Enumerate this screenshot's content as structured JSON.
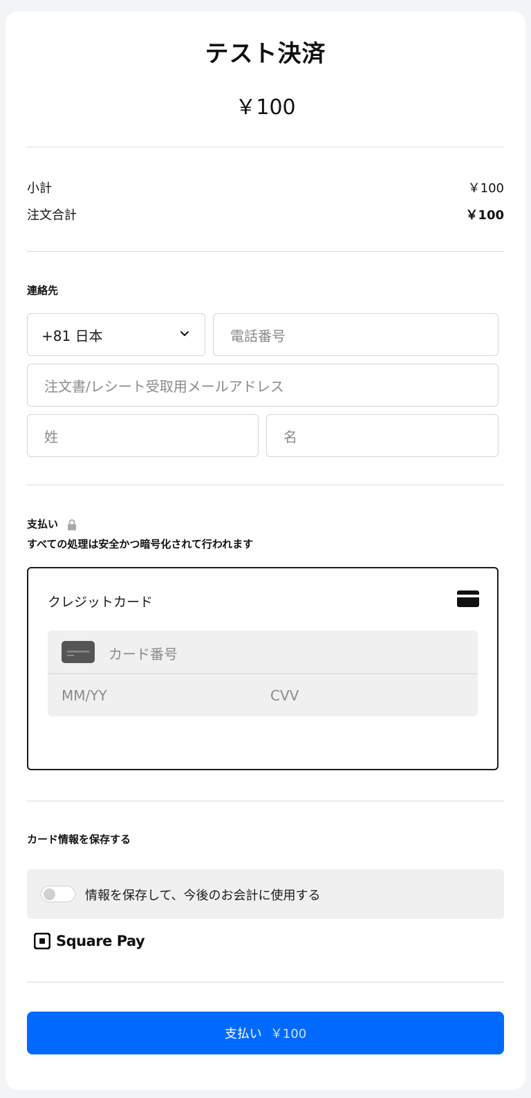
{
  "header": {
    "title": "テスト決済",
    "amount": "￥100"
  },
  "summary": {
    "subtotal_label": "小計",
    "subtotal_value": "￥100",
    "total_label": "注文合計",
    "total_value": "￥100"
  },
  "contact": {
    "section_label": "連絡先",
    "country_select": "+81 日本",
    "phone_placeholder": "電話番号",
    "email_placeholder": "注文書/レシート受取用メールアドレス",
    "last_name_placeholder": "姓",
    "first_name_placeholder": "名"
  },
  "payment": {
    "section_label": "支払い",
    "security_note": "すべての処理は安全かつ暗号化されて行われます",
    "method_label": "クレジットカード",
    "card_number_placeholder": "カード番号",
    "expiry_placeholder": "MM/YY",
    "cvv_placeholder": "CVV"
  },
  "save_card": {
    "section_label": "カード情報を保存する",
    "toggle_label": "情報を保存して、今後のお会計に使用する",
    "toggle_on": false
  },
  "brand": {
    "name": "Square Pay"
  },
  "pay_button": {
    "label": "支払い",
    "amount": "￥100",
    "color": "#006aff"
  }
}
